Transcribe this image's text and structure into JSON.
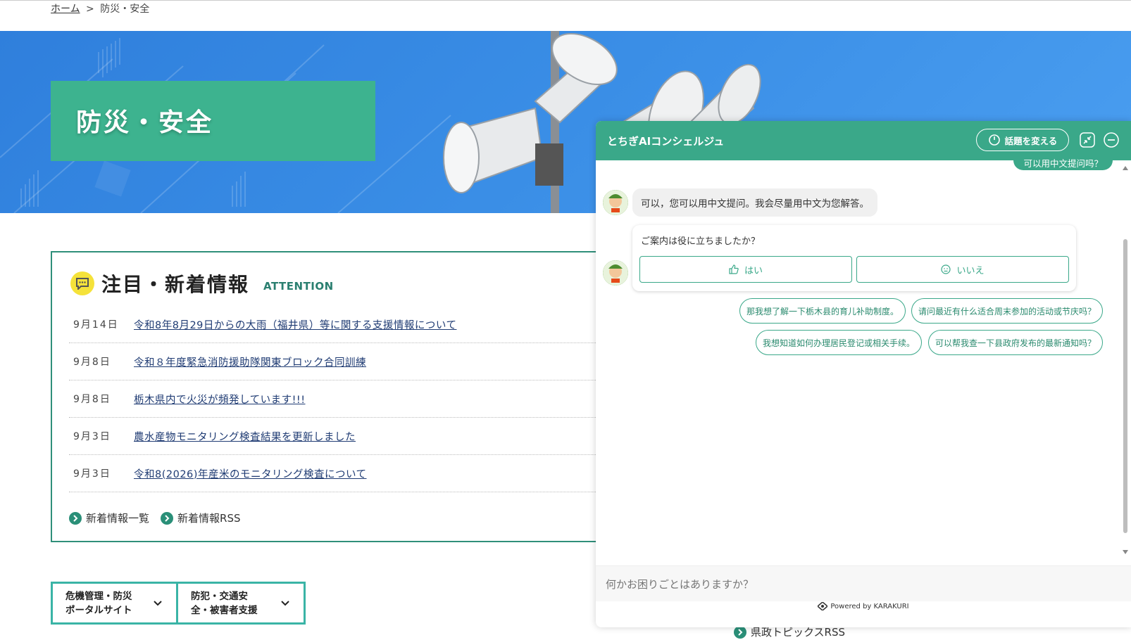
{
  "breadcrumb": {
    "home": "ホーム",
    "sep": ">",
    "current": "防災・安全"
  },
  "hero": {
    "title": "防災・安全"
  },
  "news": {
    "title": "注目・新着情報",
    "subtitle": "ATTENTION",
    "items": [
      {
        "date": "9月14日",
        "text": "令和8年8月29日からの大雨（福井県）等に関する支援情報について"
      },
      {
        "date": "9月8日",
        "text": "令和８年度緊急消防援助隊関東ブロック合同訓練"
      },
      {
        "date": "9月8日",
        "text": "栃木県内で火災が頻発しています!!!"
      },
      {
        "date": "9月3日",
        "text": "農水産物モニタリング検査結果を更新しました"
      },
      {
        "date": "9月3日",
        "text": "令和8(2026)年産米のモニタリング検査について"
      }
    ],
    "footer_links": {
      "list": "新着情報一覧",
      "rss": "新着情報RSS"
    }
  },
  "tabs": [
    {
      "line1": "危機管理・防災",
      "line2": "ポータルサイト"
    },
    {
      "line1": "防犯・交通安",
      "line2": "全・被害者支援"
    }
  ],
  "bottom_link": "県政トピックスRSS",
  "chat": {
    "title": "とちぎAIコンシェルジュ",
    "topic_button": "話題を変える",
    "user_prev": "可以用中文提问吗？",
    "bot_reply": "可以，您可以用中文提问。我会尽量用中文为您解答。",
    "feedback_question": "ご案内は役に立ちましたか？",
    "yes": "はい",
    "no": "いいえ",
    "suggestions": [
      "那我想了解一下栃木县的育儿补助制度。",
      "请问最近有什么适合周末参加的活动或节庆吗？",
      "我想知道如何办理居民登记或相关手续。",
      "可以帮我查一下县政府发布的最新通知吗？"
    ],
    "input_placeholder": "何かお困りごとはありますか？",
    "powered_by": "Powered by KARAKURI"
  },
  "colors": {
    "accent": "#3aa889",
    "hero_blue": "#3a8ee6",
    "hero_green": "#3db38f",
    "link": "#1f3b73"
  }
}
